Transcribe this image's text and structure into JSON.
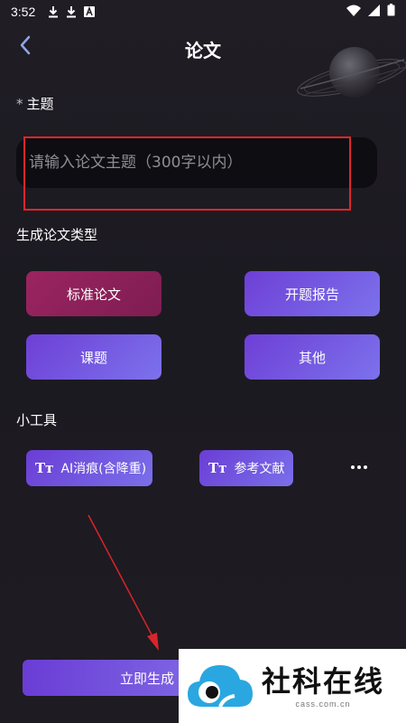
{
  "status_bar": {
    "time": "3:52",
    "left_icons": [
      "download-icon",
      "download-icon",
      "font-app-icon"
    ],
    "right_icons": [
      "wifi-icon",
      "signal-icon",
      "battery-icon"
    ]
  },
  "header": {
    "title": "论文",
    "back_icon": "chevron-left-icon"
  },
  "topic": {
    "required_mark": "*",
    "label": "主题",
    "placeholder": "请输入论文主题（300字以内）",
    "value": ""
  },
  "types": {
    "label": "生成论文类型",
    "items": [
      {
        "label": "标准论文",
        "selected": true
      },
      {
        "label": "开题报告",
        "selected": false
      },
      {
        "label": "课题",
        "selected": false
      },
      {
        "label": "其他",
        "selected": false
      }
    ]
  },
  "tools": {
    "label": "小工具",
    "icon_glyph": "Tт",
    "items": [
      {
        "label": "AI消痕(含降重)"
      },
      {
        "label": "参考文献"
      }
    ],
    "more_icon": "more-horizontal-icon"
  },
  "footer": {
    "generate_label": "立即生成"
  },
  "watermark": {
    "title": "社科在线",
    "url": "cass.com.cn"
  },
  "colors": {
    "background": "#1e1b22",
    "selected_type": "#8a2058",
    "accent_purple": "#6e3fd6",
    "annotation_red": "#e2262a"
  }
}
